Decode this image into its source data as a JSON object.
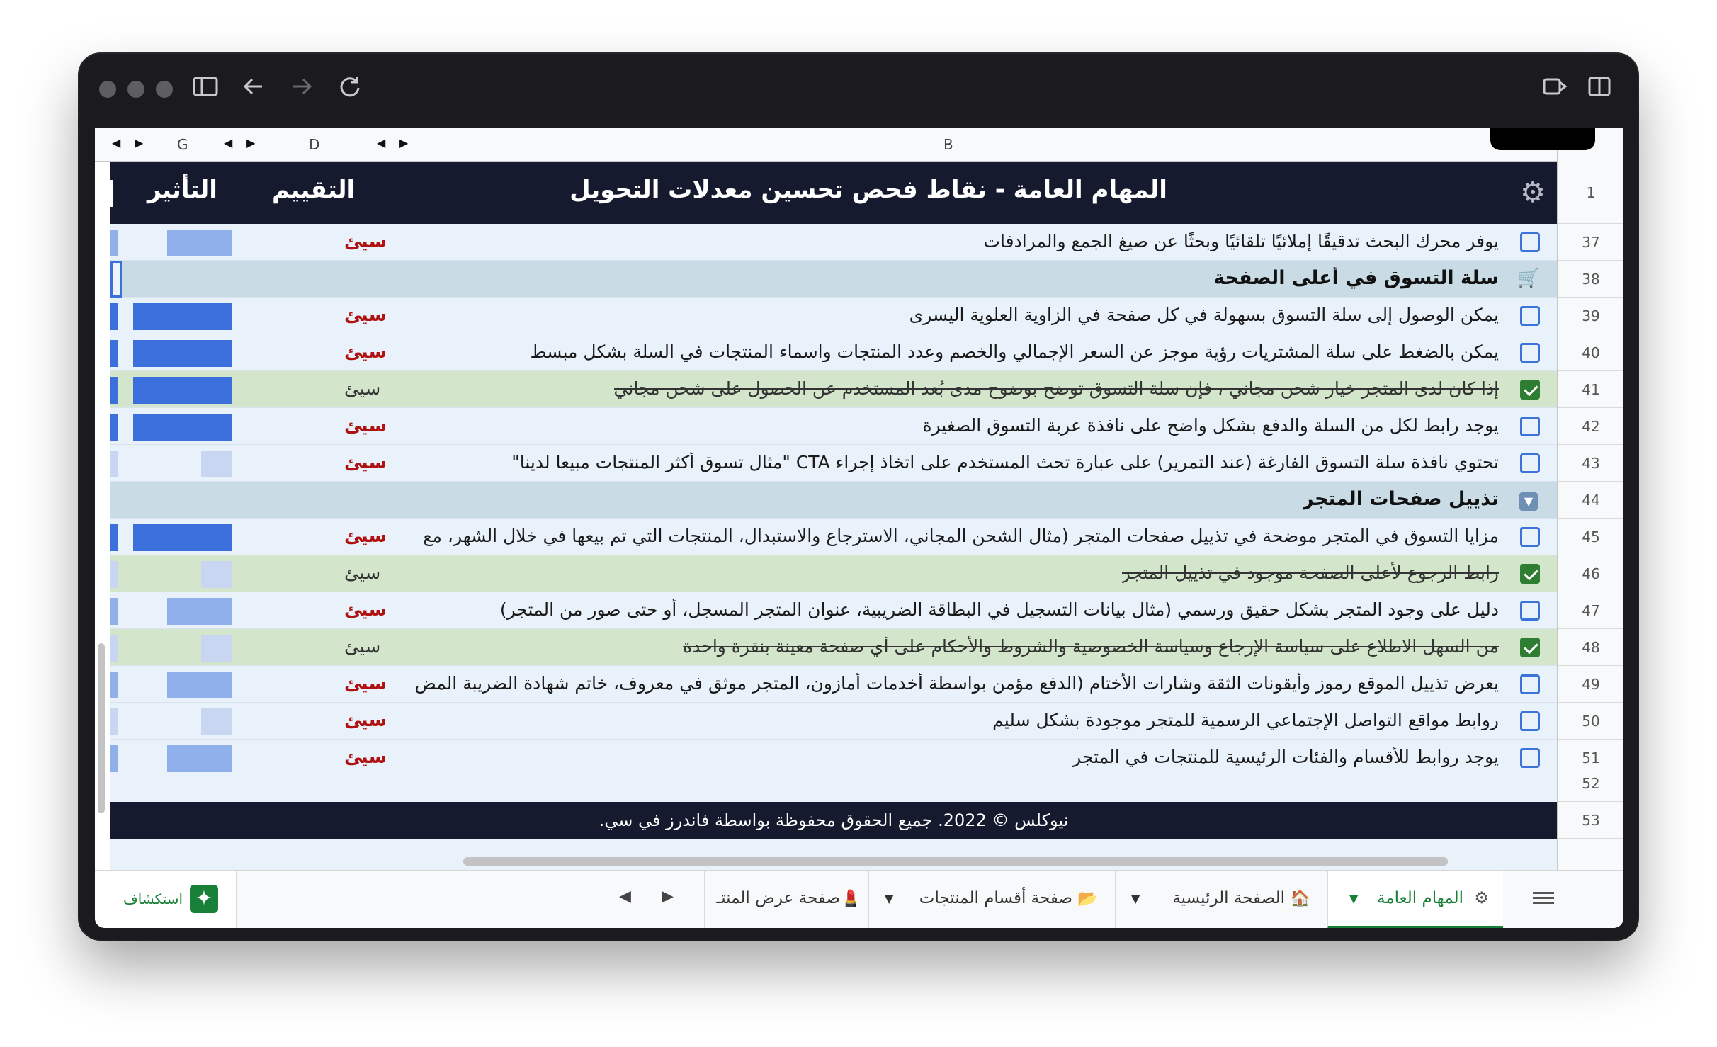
{
  "columns": {
    "g": "G",
    "d": "D",
    "b": "B"
  },
  "header": {
    "title": "المهام العامة - نقاط فحص تحسين معدلات التحويل",
    "rating_col": "التقييم",
    "impact_col": "التأثير",
    "row_number": "1"
  },
  "rows": [
    {
      "num": "37",
      "text": "يوفر محرك البحث تدقيقًا إملائيًا تلقائيًا وبحثًا عن صيغ الجمع والمرادفات",
      "rating": "سيئ",
      "type": "item",
      "checked": false,
      "impact": 2
    },
    {
      "num": "38",
      "text": "سلة التسوق في أعلى الصفحة",
      "rating": "",
      "type": "section",
      "icon": "cart-icon"
    },
    {
      "num": "39",
      "text": "يمكن الوصول إلى سلة التسوق بسهولة في كل صفحة في الزاوية العلوية اليسرى",
      "rating": "سيئ",
      "type": "item",
      "checked": false,
      "impact": 3
    },
    {
      "num": "40",
      "text": "يمكن بالضغط على سلة المشتريات رؤية موجز عن السعر الإجمالي والخصم وعدد المنتجات واسماء المنتجات في السلة بشكل مبسط",
      "rating": "سيئ",
      "type": "item",
      "checked": false,
      "impact": 3
    },
    {
      "num": "41",
      "text": "إذا كان لدى المتجر خيار شحن مجاني ، فإن سلة التسوق توضح بوضوح مدى بُعد المستخدم عن الحصول على شحن مجاني",
      "rating": "سيئ",
      "type": "done",
      "checked": true,
      "impact": 3
    },
    {
      "num": "42",
      "text": "يوجد رابط لكل من السلة والدفع بشكل واضح على نافذة عربة التسوق الصغيرة",
      "rating": "سيئ",
      "type": "item",
      "checked": false,
      "impact": 3
    },
    {
      "num": "43",
      "text": "تحتوي نافذة سلة التسوق الفارغة (عند التمرير) على عبارة تحث المستخدم على اتخاذ إجراء CTA \"مثال تسوق أكثر المنتجات مبيعا لدينا\"",
      "rating": "سيئ",
      "type": "item",
      "checked": false,
      "impact": 1
    },
    {
      "num": "44",
      "text": "تذييل صفحات المتجر",
      "rating": "",
      "type": "section",
      "icon": "chevron-down-icon"
    },
    {
      "num": "45",
      "text": "مزايا التسوق في المتجر موضحة في تذييل صفحات المتجر (مثال الشحن المجاني، الاسترجاع والاستبدال، المنتجات التي تم بيعها في خلال الشهر، مع",
      "rating": "سيئ",
      "type": "item",
      "checked": false,
      "impact": 3
    },
    {
      "num": "46",
      "text": "رابط الرجوع لأعلى الصفحة موجود في تذييل المتجر",
      "rating": "سيئ",
      "type": "done",
      "checked": true,
      "impact": 1
    },
    {
      "num": "47",
      "text": "دليل على وجود المتجر بشكل حقيق ورسمي (مثال بيانات التسجيل في البطاقة الضريبية، عنوان المتجر المسجل، أو حتى صور من المتجر)",
      "rating": "سيئ",
      "type": "item",
      "checked": false,
      "impact": 2
    },
    {
      "num": "48",
      "text": "من السهل الاطلاع على سياسة الإرجاع وسياسة الخصوصية والشروط والأحكام على أي صفحة معينة بنقرة واحدة",
      "rating": "سيئ",
      "type": "done",
      "checked": true,
      "impact": 1
    },
    {
      "num": "49",
      "text": "يعرض تذييل الموقع رموز وأيقونات الثقة وشارات الأختام (الدفع مؤمن بواسطة أخدمات أمازون، المتجر موثق في معروف، خاتم شهادة الضريبة المض",
      "rating": "سيئ",
      "type": "item",
      "checked": false,
      "impact": 2
    },
    {
      "num": "50",
      "text": "روابط مواقع التواصل الإجتماعي الرسمية للمتجر موجودة بشكل سليم",
      "rating": "سيئ",
      "type": "item",
      "checked": false,
      "impact": 1
    },
    {
      "num": "51",
      "text": "يوجد روابط للأقسام والفئات الرئيسية للمنتجات في المتجر",
      "rating": "سيئ",
      "type": "item",
      "checked": false,
      "impact": 2
    }
  ],
  "empty_row": "52",
  "footer": {
    "text": "نيوكلس © 2022. جميع الحقوق محفوظة بواسطة فاندرز في سي.",
    "row_number": "53"
  },
  "tabs": [
    {
      "label": "المهام العامة",
      "icon": "gear-icon",
      "active": true
    },
    {
      "label": "الصفحة الرئيسية",
      "icon": "home-icon",
      "active": false
    },
    {
      "label": "صفحة أقسام المنتجات",
      "icon": "folder-icon",
      "active": false
    },
    {
      "label": "صفحة عرض المنتـ",
      "icon": "lipstick-icon",
      "active": false
    }
  ],
  "explore_label": "استكشاف",
  "colors": {
    "impact_strong": "#3a6fdc",
    "impact_medium": "#8fb0ea",
    "impact_light": "#c8d6f2",
    "rating_bad": "#b01212",
    "header_bg": "#161a2e",
    "done_bg": "#d3e6cb",
    "section_bg": "#c9dce5"
  }
}
